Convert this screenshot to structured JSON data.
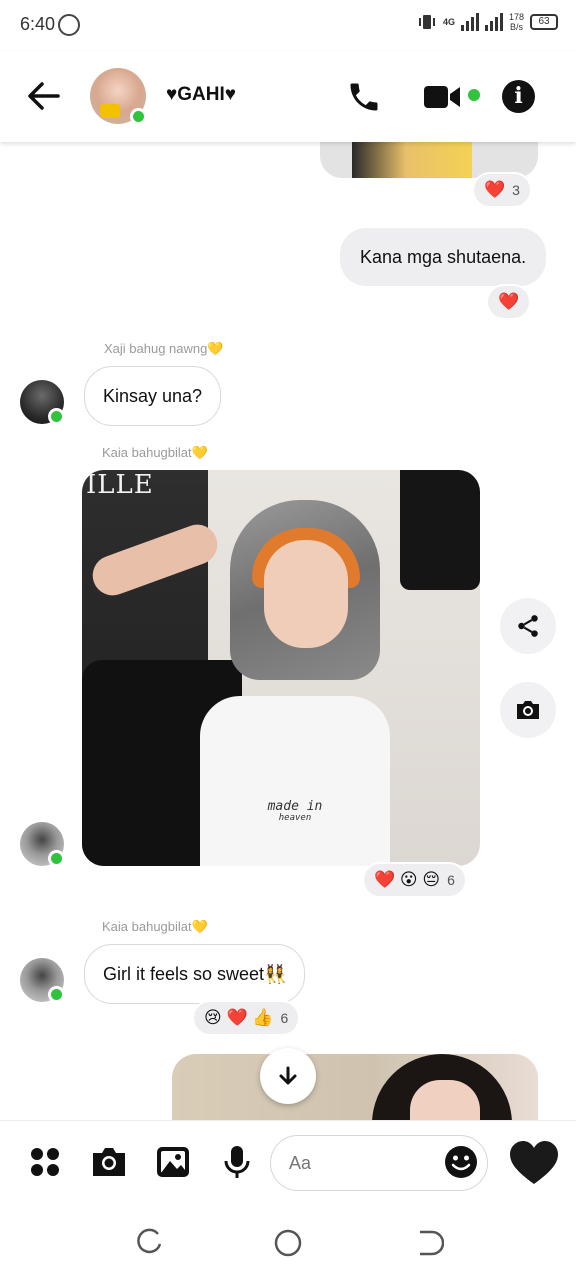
{
  "status_bar": {
    "time": "6:40",
    "network_type": "4G",
    "net_speed_value": "178",
    "net_speed_unit": "B/s",
    "battery": "63"
  },
  "header": {
    "contact_name": "♥GAHI♥",
    "online": true
  },
  "messages": {
    "out_reaction_count": "3",
    "out_text": "Kana mga shutaena.",
    "reply1_label": "Xaji bahug nawng💛",
    "reply1_text": "Kinsay una?",
    "reply2_label": "Kaia bahugbilat💛",
    "photo_wall_text": "ILLE",
    "photo_shirt_line1": "made in",
    "photo_shirt_line2": "heaven",
    "photo_reaction_count": "6",
    "reply3_label": "Kaia bahugbilat💛",
    "reply3_text": "Girl it feels so sweet👯‍♀️",
    "reply3_reaction_count": "6"
  },
  "reactions": {
    "out1": "❤️",
    "out2": "❤️",
    "photo": "❤️ 😮 😔",
    "reply3": "😢 ❤️ 👍"
  },
  "composer": {
    "placeholder": "Aa"
  },
  "colors": {
    "accent": "#111111",
    "online": "#31c23e",
    "bubble_out": "#eeeef0"
  },
  "icons": [
    "back-arrow-icon",
    "phone-icon",
    "video-camera-icon",
    "info-icon",
    "share-icon",
    "camera-icon",
    "apps-icon",
    "image-icon",
    "microphone-icon",
    "emoji-icon",
    "heart-icon",
    "chevron-down-icon"
  ]
}
